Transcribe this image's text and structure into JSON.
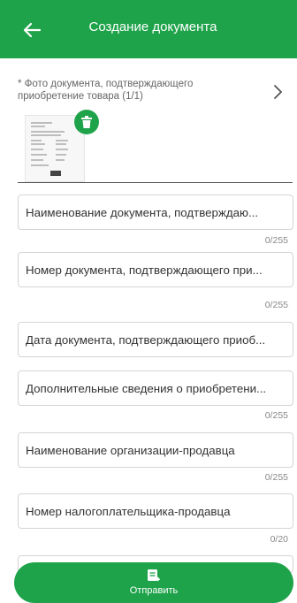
{
  "header": {
    "title": "Создание документа"
  },
  "photo": {
    "label": "* Фото документа, подтверждающего приобретение товара (1/1)"
  },
  "fields": [
    {
      "placeholder": "Наименование документа, подтверждаю...",
      "counter": "0/255"
    },
    {
      "placeholder": "Номер документа, подтверждающего при...",
      "counter": "0/255"
    },
    {
      "placeholder": "Дата документа, подтверждающего приоб..."
    },
    {
      "placeholder": "Дополнительные сведения о приобретени...",
      "counter": "0/255"
    },
    {
      "placeholder": "Наименование организации-продавца",
      "counter": "0/255"
    },
    {
      "placeholder": "Номер налогоплательщика-продавца",
      "counter": "0/20"
    }
  ],
  "footer": {
    "submit_label": "Отправить"
  },
  "colors": {
    "accent": "#1fa34a"
  }
}
